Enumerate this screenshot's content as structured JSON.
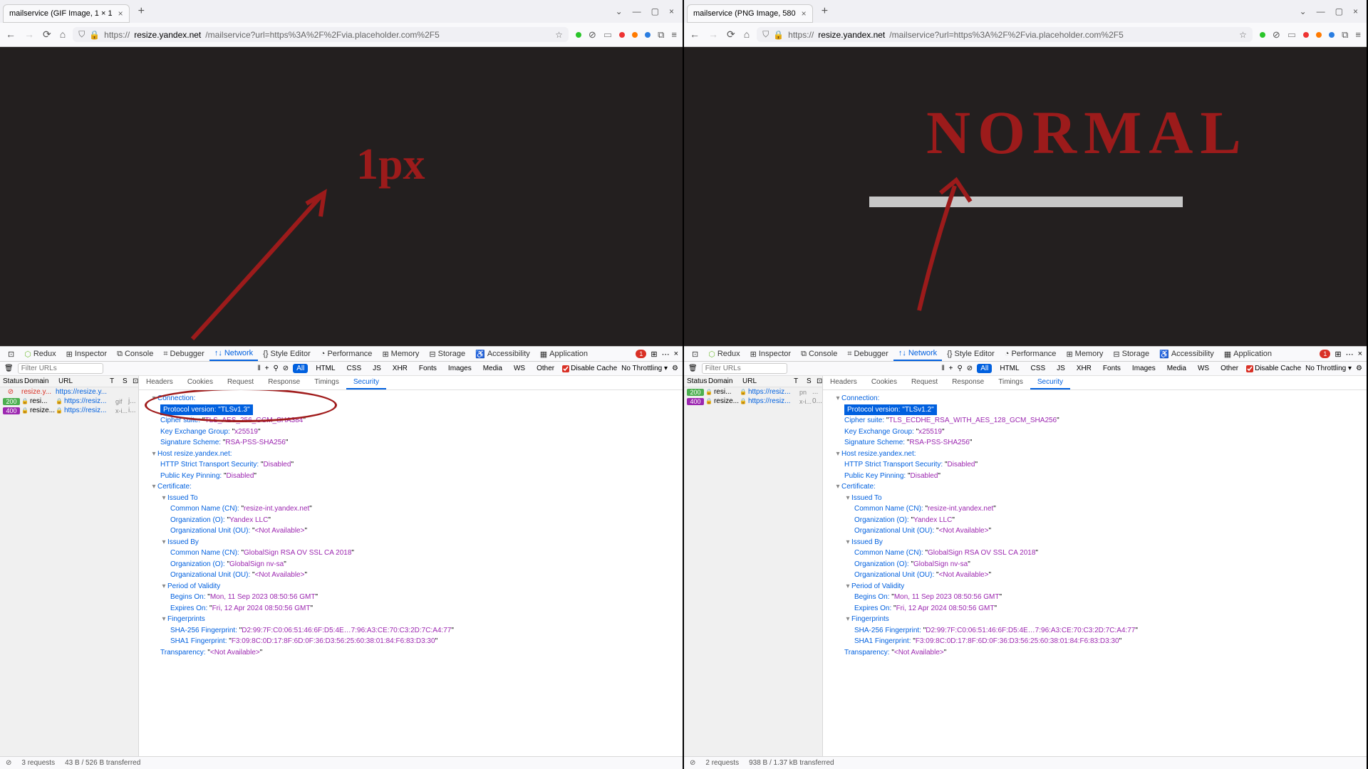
{
  "left": {
    "tab_title": "mailservice (GIF Image, 1 × 1",
    "url_prefix": "https://",
    "url_domain": "resize.yandex.net",
    "url_path": "/mailservice?url=https%3A%2F%2Fvia.placeholder.com%2F5",
    "annotation": "1px",
    "content_img_label": "",
    "requests": [
      {
        "status": "",
        "status_class": "stx",
        "domain": "resize.y...",
        "url": "https://resize.y...",
        "type": "",
        "x": ""
      },
      {
        "status": "200",
        "status_class": "st200",
        "domain": "resi...",
        "url": "https://resiz...",
        "type": "gif",
        "x": "j..."
      },
      {
        "status": "400",
        "status_class": "st400",
        "domain": "resize...",
        "url": "https://resiz...",
        "type": "x-i...",
        "x": "i..."
      }
    ],
    "protocol_version": "TLSv1.3",
    "cipher_suite": "TLS_AES_256_GCM_SHA384",
    "key_exchange_group": "x25519",
    "status_summary": {
      "req": "3 requests",
      "xfer": "43 B / 526 B transferred"
    }
  },
  "right": {
    "tab_title": "mailservice (PNG Image, 580",
    "url_prefix": "https://",
    "url_domain": "resize.yandex.net",
    "url_path": "/mailservice?url=https%3A%2F%2Fvia.placeholder.com%2F5",
    "annotation": "NORMAL",
    "content_img_label": "",
    "requests": [
      {
        "status": "200",
        "status_class": "st200",
        "domain": "resi...",
        "url": "https://resiz...",
        "type": "pn",
        "x": "..."
      },
      {
        "status": "400",
        "status_class": "st400",
        "domain": "resize...",
        "url": "https://resiz...",
        "type": "x-i...",
        "x": "0..."
      }
    ],
    "protocol_version": "TLSv1.2",
    "cipher_suite": "TLS_ECDHE_RSA_WITH_AES_128_GCM_SHA256",
    "key_exchange_group": "x25519",
    "status_summary": {
      "req": "2 requests",
      "xfer": "938 B / 1.37 kB transferred"
    }
  },
  "common": {
    "devtabs": [
      "Redux",
      "Inspector",
      "Console",
      "Debugger",
      "Network",
      "Style Editor",
      "Performance",
      "Memory",
      "Storage",
      "Accessibility",
      "Application"
    ],
    "devtabs_active": "Network",
    "filter_placeholder": "Filter URLs",
    "filter_pills": [
      "All",
      "HTML",
      "CSS",
      "JS",
      "XHR",
      "Fonts",
      "Images",
      "Media",
      "WS",
      "Other"
    ],
    "disable_cache": "Disable Cache",
    "throttling": "No Throttling",
    "reqhead": {
      "status": "Status",
      "domain": "Domain",
      "url": "URL",
      "t": "T",
      "s": "S"
    },
    "dtabs": [
      "Headers",
      "Cookies",
      "Request",
      "Response",
      "Timings",
      "Security"
    ],
    "dtabs_active": "Security",
    "security": {
      "connection": "Connection:",
      "protocol": "Protocol version:",
      "cipher": "Cipher suite:",
      "kex": "Key Exchange Group:",
      "sig": "Signature Scheme:",
      "sig_v": "RSA-PSS-SHA256",
      "host": "Host resize.yandex.net:",
      "hsts": "HTTP Strict Transport Security:",
      "hsts_v": "Disabled",
      "pkp": "Public Key Pinning:",
      "pkp_v": "Disabled",
      "cert": "Certificate:",
      "issued_to": "Issued To",
      "cn": "Common Name (CN):",
      "cn_v": "resize-int.yandex.net",
      "o": "Organization (O):",
      "o_v": "Yandex LLC",
      "ou": "Organizational Unit (OU):",
      "na": "<Not Available>",
      "issued_by": "Issued By",
      "cn_by_v": "GlobalSign RSA OV SSL CA 2018",
      "o_by_v": "GlobalSign nv-sa",
      "validity": "Period of Validity",
      "begins": "Begins On:",
      "begins_v": "Mon, 11 Sep 2023 08:50:56 GMT",
      "expires": "Expires On:",
      "expires_v": "Fri, 12 Apr 2024 08:50:56 GMT",
      "fp": "Fingerprints",
      "sha256": "SHA-256 Fingerprint:",
      "sha256_v": "D2:99:7F:C0:06:51:46:6F:D5:4E…7:96:A3:CE:70:C3:2D:7C:A4:77",
      "sha1": "SHA1 Fingerprint:",
      "sha1_v": "F3:09:8C:0D:17:8F:6D:0F:36:D3:56:25:60:38:01:84:F6:83:D3:30",
      "transparency": "Transparency:",
      "err_count": "1"
    }
  }
}
